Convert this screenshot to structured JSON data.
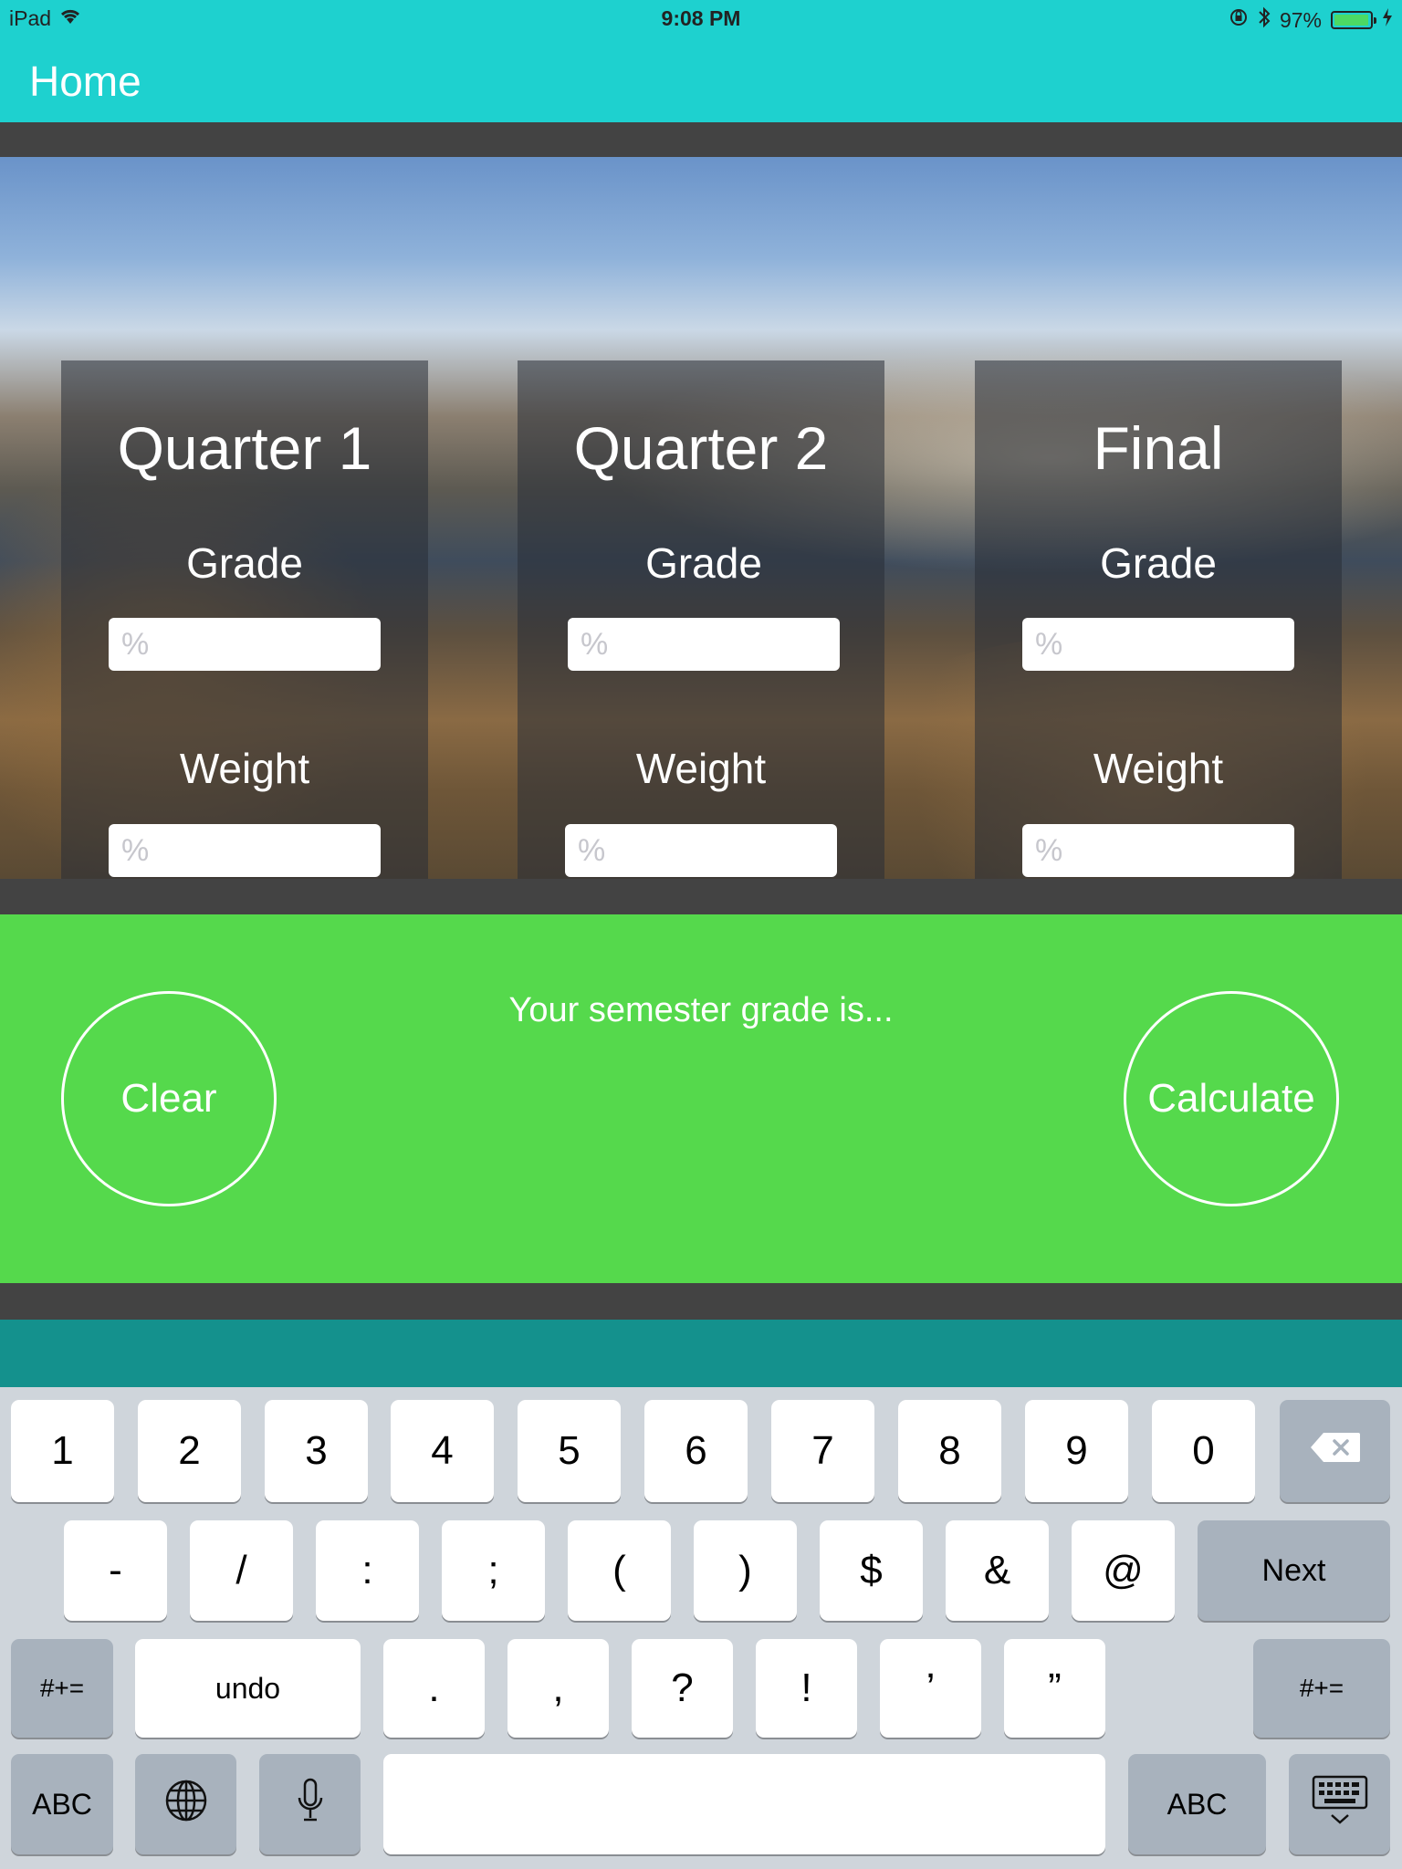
{
  "status_bar": {
    "device": "iPad",
    "time": "9:08 PM",
    "battery_percent": "97%",
    "battery_level": 0.97,
    "icons": [
      "wifi-icon",
      "rotation-lock-icon",
      "bluetooth-icon",
      "battery-icon",
      "charging-icon"
    ]
  },
  "nav": {
    "title": "Home"
  },
  "cards": [
    {
      "title": "Quarter 1",
      "grade_label": "Grade",
      "weight_label": "Weight",
      "grade_placeholder": "%",
      "weight_placeholder": "%",
      "grade_value": "",
      "weight_value": ""
    },
    {
      "title": "Quarter 2",
      "grade_label": "Grade",
      "weight_label": "Weight",
      "grade_placeholder": "%",
      "weight_placeholder": "%",
      "grade_value": "",
      "weight_value": ""
    },
    {
      "title": "Final",
      "grade_label": "Grade",
      "weight_label": "Weight",
      "grade_placeholder": "%",
      "weight_placeholder": "%",
      "grade_value": "",
      "weight_value": ""
    }
  ],
  "result": {
    "message": "Your semester grade is...",
    "clear_label": "Clear",
    "calculate_label": "Calculate"
  },
  "keyboard": {
    "row1": [
      "1",
      "2",
      "3",
      "4",
      "5",
      "6",
      "7",
      "8",
      "9",
      "0"
    ],
    "backspace_icon": "backspace-icon",
    "row2": [
      "-",
      "/",
      ":",
      ";",
      "(",
      ")",
      "$",
      "&",
      "@"
    ],
    "next_label": "Next",
    "row3_left": "#+=",
    "undo_label": "undo",
    "row3": [
      ".",
      ",",
      "?",
      "!",
      "’",
      "”"
    ],
    "row3_right": "#+=",
    "abc_left": "ABC",
    "globe_icon": "globe-icon",
    "mic_icon": "microphone-icon",
    "abc_right": "ABC",
    "dismiss_icon": "keyboard-dismiss-icon"
  },
  "colors": {
    "nav_bg": "#1ed1cf",
    "band_dark": "#434343",
    "result_green": "#55d94c",
    "teal_strip": "#14918d",
    "keyboard_bg": "#cfd5db",
    "fn_key": "#a8b2bd"
  }
}
